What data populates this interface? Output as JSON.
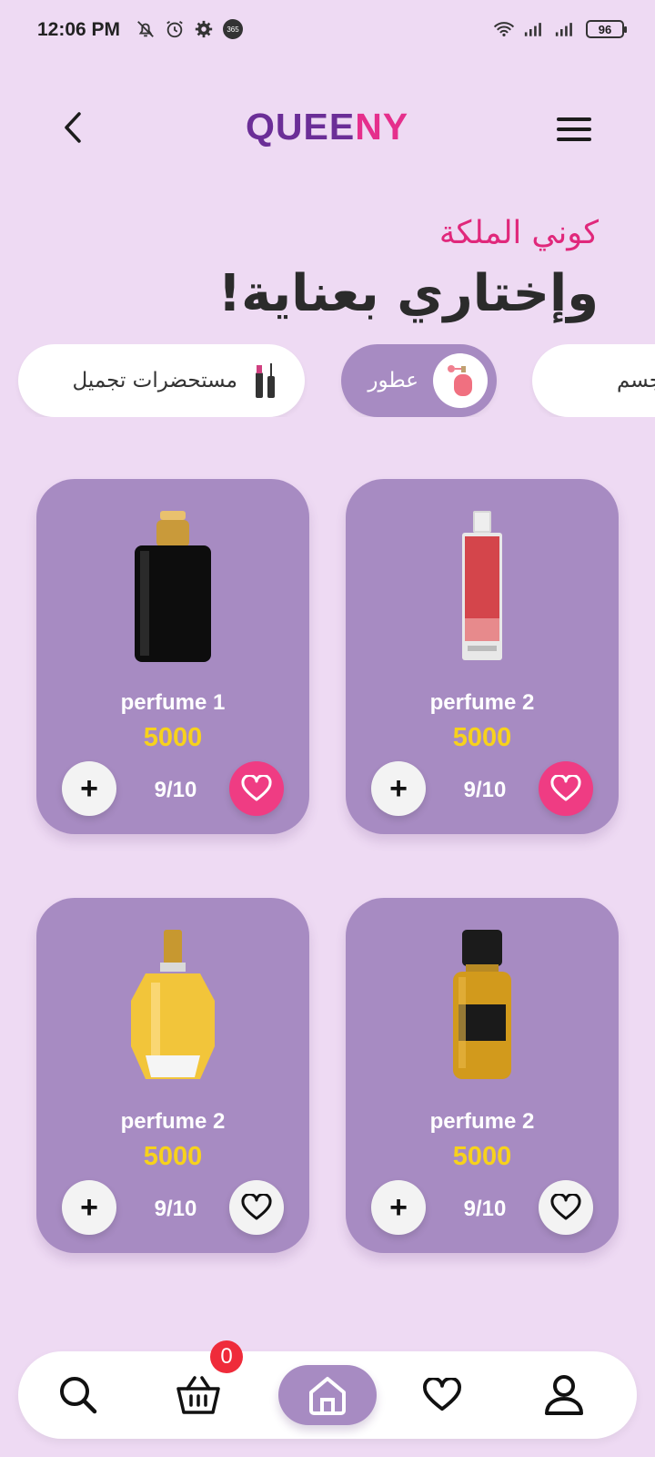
{
  "status_bar": {
    "time": "12:06 PM",
    "battery": "96"
  },
  "header": {
    "logo_part1": "QUEE",
    "logo_part2": "NY"
  },
  "heading": {
    "subtitle": "كوني الملكة",
    "title": "وإختاري بعناية!"
  },
  "categories": [
    {
      "label": "مستحضرات تجميل",
      "icon": "makeup-icon",
      "active": false
    },
    {
      "label": "عطور",
      "icon": "perfume-icon",
      "active": true
    },
    {
      "label": "منتجات جسم",
      "icon": "body-icon",
      "active": false
    }
  ],
  "products": [
    {
      "name": "perfume 1",
      "price": "5000",
      "rating": "9/10",
      "favorite": true,
      "bottle": "black"
    },
    {
      "name": "perfume 2",
      "price": "5000",
      "rating": "9/10",
      "favorite": true,
      "bottle": "red"
    },
    {
      "name": "perfume 2",
      "price": "5000",
      "rating": "9/10",
      "favorite": false,
      "bottle": "gold"
    },
    {
      "name": "perfume 2",
      "price": "5000",
      "rating": "9/10",
      "favorite": false,
      "bottle": "amber"
    }
  ],
  "nav": {
    "cart_count": "0"
  },
  "colors": {
    "background": "#eedaf3",
    "card": "#a78bc2",
    "accent_pink": "#e52f8c",
    "price_yellow": "#f7d21c",
    "logo_purple": "#6b2e97"
  }
}
